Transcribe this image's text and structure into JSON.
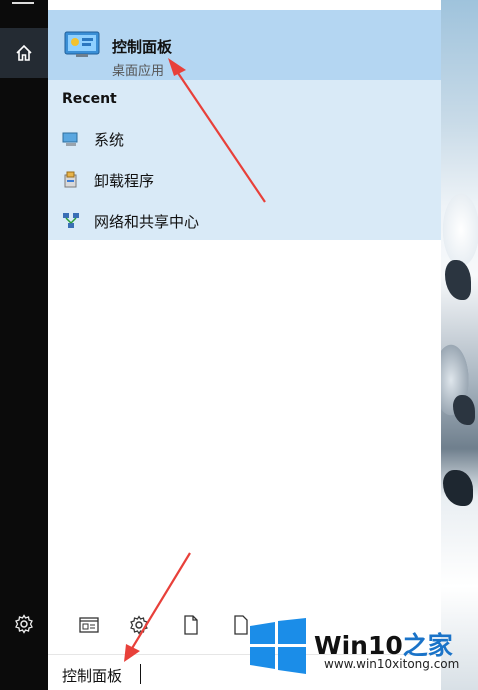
{
  "best_match": {
    "title": "控制面板",
    "subtitle": "桌面应用",
    "icon": "control-panel-icon"
  },
  "recent": {
    "heading": "Recent",
    "items": [
      {
        "label": "系统",
        "icon": "system-icon"
      },
      {
        "label": "卸载程序",
        "icon": "uninstall-programs-icon"
      },
      {
        "label": "网络和共享中心",
        "icon": "network-sharing-center-icon"
      }
    ]
  },
  "filters": [
    {
      "icon": "apps-filter-icon"
    },
    {
      "icon": "settings-filter-icon"
    },
    {
      "icon": "documents-filter-icon"
    },
    {
      "icon": "folders-filter-icon"
    }
  ],
  "search": {
    "query": "控制面板"
  },
  "sidebar": {
    "home_icon": "home-icon",
    "settings_icon": "gear-icon"
  },
  "watermark": {
    "brand": "Win10",
    "brand_cn": "之家",
    "url": "www.win10xitong.com"
  },
  "colors": {
    "highlight": "#b4d6f2",
    "recent_bg": "#d9eaf7",
    "accent": "#1a73c8",
    "annotation_arrow": "#e8403a"
  }
}
